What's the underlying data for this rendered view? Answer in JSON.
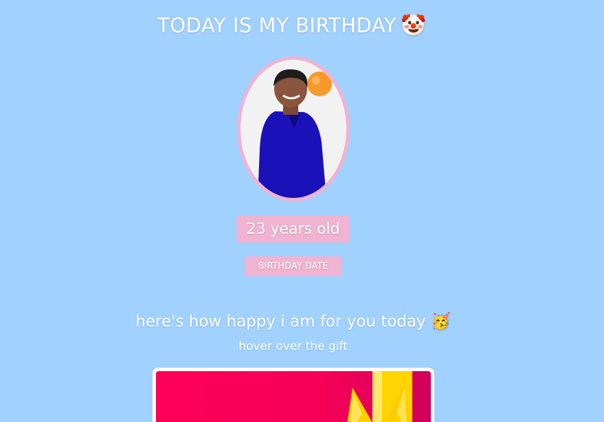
{
  "header": {
    "title": "TODAY IS MY BIRTHDAY",
    "title_emoji": "🤡"
  },
  "profile": {
    "photo_icon": "portrait-photo",
    "age_text": "23 years old",
    "date_button": "BIRTHDAY DATE"
  },
  "gift_section": {
    "heading": "here's how happy i am for you today",
    "heading_emoji": "🥳",
    "hint": "hover over the gift"
  },
  "colors": {
    "background": "#a1d1fe",
    "accent_pink": "#f0b3d1",
    "gift_red": "#ff0057",
    "ribbon_gold": "#ffd400"
  }
}
